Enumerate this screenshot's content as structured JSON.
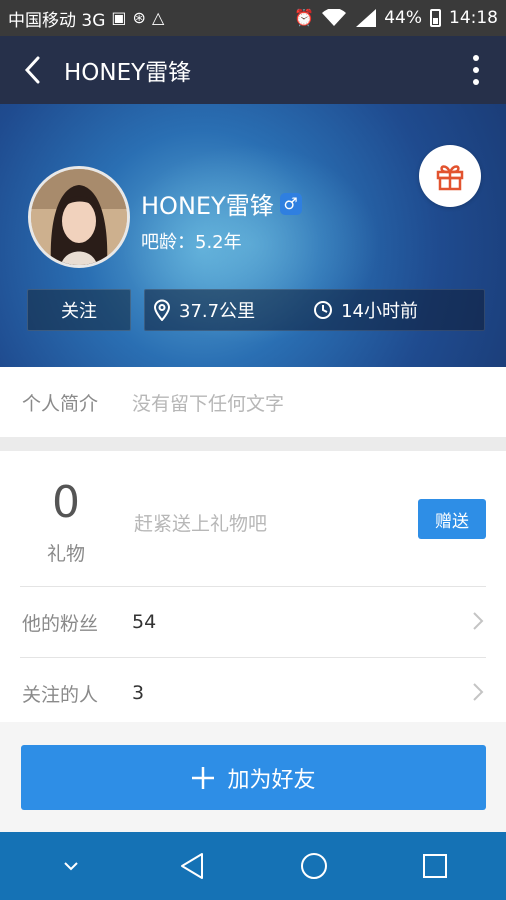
{
  "status_bar": {
    "carrier": "中国移动 3G",
    "battery": "44%",
    "time": "14:18"
  },
  "app_bar": {
    "title": "HONEY雷锋"
  },
  "profile": {
    "name": "HONEY雷锋",
    "gender_symbol": "♂",
    "tieba_age": "吧龄：5.2年",
    "follow_label": "关注",
    "distance": "37.7公里",
    "last_active": "14小时前"
  },
  "bio": {
    "label": "个人简介",
    "text": "没有留下任何文字"
  },
  "gifts": {
    "count": "0",
    "label": "礼物",
    "prompt": "赶紧送上礼物吧",
    "send_label": "赠送"
  },
  "stats": [
    {
      "label": "他的粉丝",
      "value": "54"
    },
    {
      "label": "关注的人",
      "value": "3"
    }
  ],
  "actions": {
    "add_friend_label": "加为好友"
  },
  "colors": {
    "accent": "#2e8ee6",
    "app_bar": "#26304a",
    "nav_bar": "#1572b5"
  }
}
